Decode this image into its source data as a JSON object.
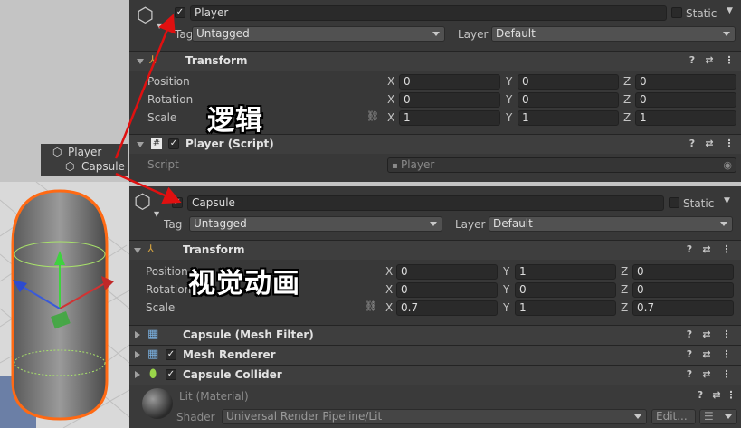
{
  "hierarchy": {
    "parent": "Player",
    "child": "Capsule"
  },
  "player": {
    "name": "Player",
    "static_label": "Static",
    "tag_label": "Tag",
    "tag_value": "Untagged",
    "layer_label": "Layer",
    "layer_value": "Default",
    "transform_title": "Transform",
    "position_label": "Position",
    "rotation_label": "Rotation",
    "scale_label": "Scale",
    "position": {
      "x": "0",
      "y": "0",
      "z": "0"
    },
    "rotation": {
      "x": "0",
      "y": "0",
      "z": "0"
    },
    "scale": {
      "x": "1",
      "y": "1",
      "z": "1"
    },
    "script_title": "Player (Script)",
    "script_label": "Script",
    "script_value": "Player"
  },
  "capsule": {
    "name": "Capsule",
    "static_label": "Static",
    "tag_label": "Tag",
    "tag_value": "Untagged",
    "layer_label": "Layer",
    "layer_value": "Default",
    "transform_title": "Transform",
    "position_label": "Position",
    "rotation_label": "Rotation",
    "scale_label": "Scale",
    "position": {
      "x": "0",
      "y": "1",
      "z": "0"
    },
    "rotation": {
      "x": "0",
      "y": "0",
      "z": "0"
    },
    "scale": {
      "x": "0.7",
      "y": "1",
      "z": "0.7"
    },
    "mesh_filter_title": "Capsule (Mesh Filter)",
    "mesh_renderer_title": "Mesh Renderer",
    "collider_title": "Capsule Collider",
    "material_title": "Lit (Material)",
    "shader_label": "Shader",
    "shader_value": "Universal Render Pipeline/Lit",
    "edit_label": "Edit..."
  },
  "axes": {
    "x": "X",
    "y": "Y",
    "z": "Z"
  },
  "annotations": {
    "logic": "逻辑",
    "visual": "视觉动画"
  },
  "colors": {
    "arrow": "#e01010",
    "panel": "#383838",
    "selection_outline": "#ff7a1a"
  }
}
